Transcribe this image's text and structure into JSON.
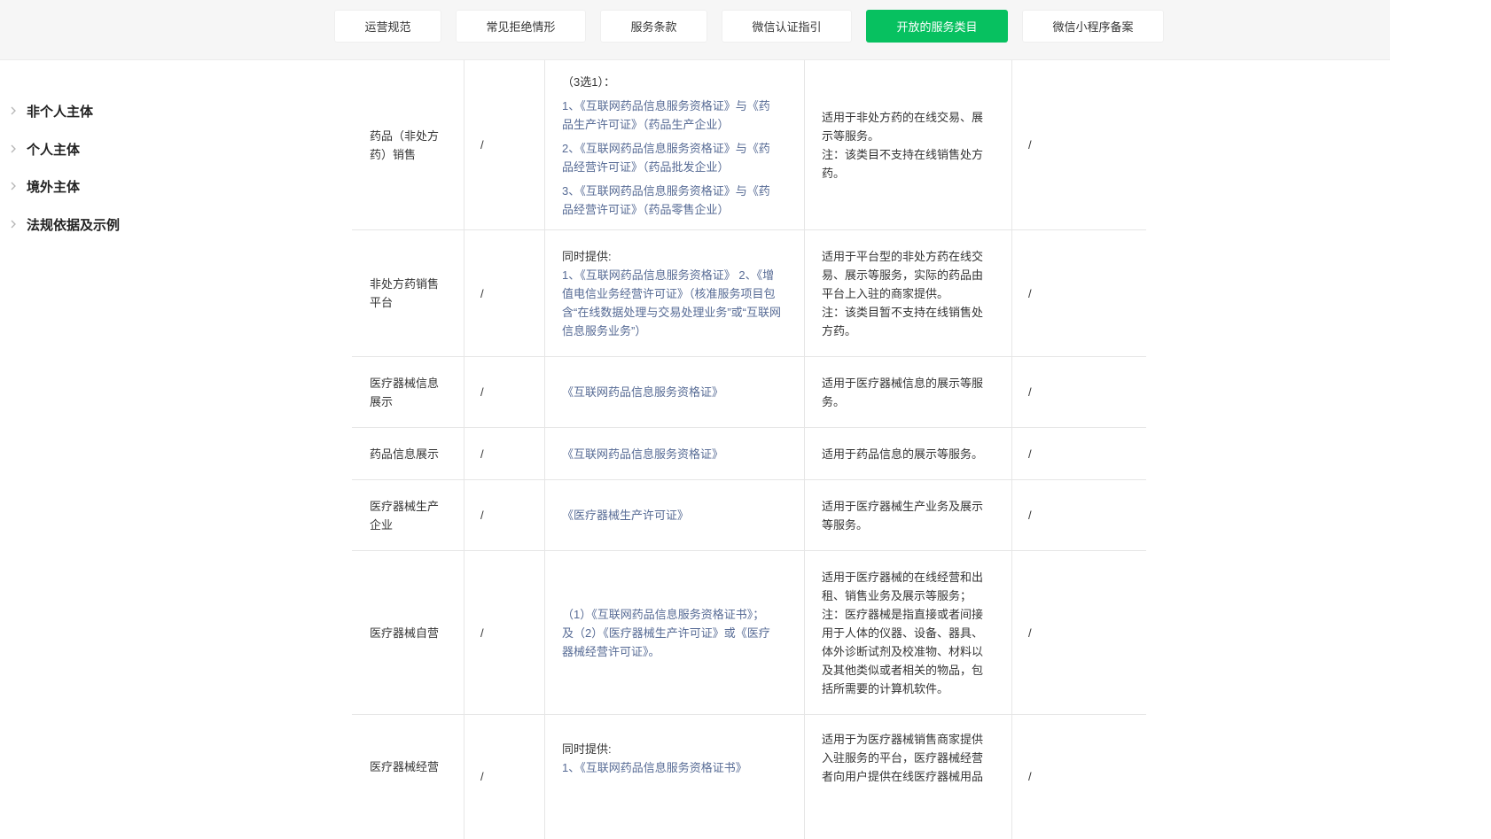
{
  "tabs": [
    {
      "label": "运营规范",
      "active": false
    },
    {
      "label": "常见拒绝情形",
      "active": false
    },
    {
      "label": "服务条款",
      "active": false
    },
    {
      "label": "微信认证指引",
      "active": false
    },
    {
      "label": "开放的服务类目",
      "active": true
    },
    {
      "label": "微信小程序备案",
      "active": false
    }
  ],
  "sidebar": {
    "items": [
      {
        "label": "非个人主体"
      },
      {
        "label": "个人主体"
      },
      {
        "label": "境外主体"
      },
      {
        "label": "法规依据及示例"
      }
    ]
  },
  "colors": {
    "accent": "#07c160",
    "link": "#576b95"
  },
  "table": {
    "rows": [
      {
        "name": [
          "药品（非处方",
          "药）销售"
        ],
        "col2": "/",
        "req": [
          "（3选1）：",
          "1、《互联网药品信息服务资格证》与《药",
          "品生产许可证》（药品生产企业）",
          "2、《互联网药品信息服务资格证》与《药",
          "品经营许可证》（药品批发企业）",
          "3、《互联网药品信息服务资格证》与《药",
          "品经营许可证》（药品零售企业）"
        ],
        "desc": [
          "适用于非处方药的在线交易、展",
          "示等服务。",
          "注：该类目不支持在线销售处方",
          "药。"
        ],
        "col5": "/"
      },
      {
        "name": [
          "非处方药销售",
          "平台"
        ],
        "col2": "/",
        "req": [
          "同时提供:",
          "1、《互联网药品信息服务资格证》 2、《增",
          "值电信业务经营许可证》（核准服务项目包",
          "含“在线数据处理与交易处理业务”或“互联网",
          "信息服务业务”）"
        ],
        "desc": [
          "适用于平台型的非处方药在线交",
          "易、展示等服务，实际的药品由",
          "平台上入驻的商家提供。",
          "注：该类目暂不支持在线销售处",
          "方药。"
        ],
        "col5": "/"
      },
      {
        "name": [
          "医疗器械信息",
          "展示"
        ],
        "col2": "/",
        "req": [
          "《互联网药品信息服务资格证》"
        ],
        "desc": [
          "适用于医疗器械信息的展示等服",
          "务。"
        ],
        "col5": "/"
      },
      {
        "name": [
          "药品信息展示"
        ],
        "col2": "/",
        "req": [
          "《互联网药品信息服务资格证》"
        ],
        "desc": [
          "适用于药品信息的展示等服务。"
        ],
        "col5": "/"
      },
      {
        "name": [
          "医疗器械生产",
          "企业"
        ],
        "col2": "/",
        "req": [
          "《医疗器械生产许可证》"
        ],
        "desc": [
          "适用于医疗器械生产业务及展示",
          "等服务。"
        ],
        "col5": "/"
      },
      {
        "name": [
          "医疗器械自营"
        ],
        "col2": "/",
        "req": [
          "（1）《互联网药品信息服务资格证书》；",
          "及（2）《医疗器械生产许可证》或《医疗",
          "器械经营许可证》。"
        ],
        "desc": [
          "适用于医疗器械的在线经营和出",
          "租、销售业务及展示等服务；",
          "注：医疗器械是指直接或者间接",
          "用于人体的仪器、设备、器具、",
          "体外诊断试剂及校准物、材料以",
          "及其他类似或者相关的物品，包",
          "括所需要的计算机软件。"
        ],
        "col5": "/"
      },
      {
        "name": [
          "医疗器械经营"
        ],
        "col2": "/",
        "req": [
          "同时提供:",
          "1、《互联网药品信息服务资格证书》"
        ],
        "desc": [
          "适用于为医疗器械销售商家提供",
          "入驻服务的平台，医疗器械经营",
          "者向用户提供在线医疗器械用品"
        ],
        "col5": "/"
      }
    ]
  }
}
